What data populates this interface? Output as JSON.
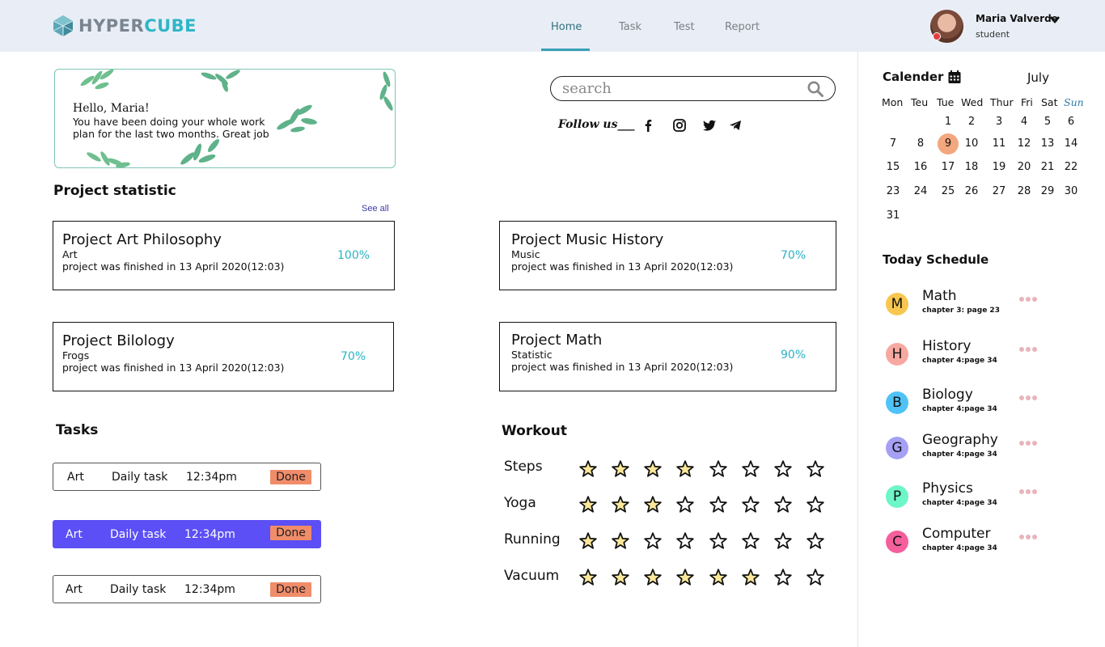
{
  "logo": {
    "part1": "HYPER",
    "part2": "CUBE"
  },
  "nav": [
    "Home",
    "Task",
    "Test",
    "Report"
  ],
  "active_nav": "Home",
  "user": {
    "name": "Maria Valverde",
    "role": "student"
  },
  "hello": {
    "greeting": "Hello, Maria!",
    "message": "You have been doing your whole work plan for the last two months. Great job"
  },
  "search": {
    "placeholder": "search"
  },
  "follow": "Follow us___",
  "social_icons": [
    "facebook-icon",
    "instagram-icon",
    "twitter-icon",
    "telegram-icon"
  ],
  "project_statistic": {
    "title": "Project statistic",
    "see_all": "See all",
    "projects": [
      {
        "title": "Project Art Philosophy",
        "subject": "Art",
        "desc": "project was finished in 13 April 2020(12:03)",
        "percent": "100%"
      },
      {
        "title": "Project Music History",
        "subject": "Music",
        "desc": "project was finished in 13 April 2020(12:03)",
        "percent": "70%"
      },
      {
        "title": "Project Bilology",
        "subject": "Frogs",
        "desc": "project was finished in 13 April 2020(12:03)",
        "percent": "70%"
      },
      {
        "title": "Project Math",
        "subject": "Statistic",
        "desc": "project was finished in 13 April 2020(12:03)",
        "percent": "90%"
      }
    ]
  },
  "tasks": {
    "title": "Tasks",
    "items": [
      {
        "subject": "Art",
        "type": "Daily task",
        "time": "12:34pm",
        "status": "Done"
      },
      {
        "subject": "Art",
        "type": "Daily task",
        "time": "12:34pm",
        "status": "Done"
      },
      {
        "subject": "Art",
        "type": "Daily task",
        "time": "12:34pm",
        "status": "Done"
      }
    ]
  },
  "workout": {
    "title": "Workout",
    "max_stars": 8,
    "rows": [
      {
        "label": "Steps",
        "filled": 4
      },
      {
        "label": "Yoga",
        "filled": 3
      },
      {
        "label": "Running",
        "filled": 2
      },
      {
        "label": "Vacuum",
        "filled": 6
      }
    ]
  },
  "calendar": {
    "title": "Calender",
    "month": "July",
    "weekdays": [
      "Mon",
      "Teu",
      "Tue",
      "Wed",
      "Thur",
      "Fri",
      "Sat",
      "Sun"
    ],
    "weeks": [
      [
        "",
        "",
        "1",
        "2",
        "3",
        "4",
        "5",
        "6"
      ],
      [
        "7",
        "8",
        "9",
        "10",
        "11",
        "12",
        "13",
        "14"
      ],
      [
        "15",
        "16",
        "17",
        "18",
        "19",
        "20",
        "21",
        "22"
      ],
      [
        "23",
        "24",
        "25",
        "26",
        "27",
        "28",
        "29",
        "30"
      ],
      [
        "31",
        "",
        "",
        "",
        "",
        "",
        "",
        ""
      ]
    ],
    "today": "9"
  },
  "schedule": {
    "title": "Today Schedule",
    "items": [
      {
        "letter": "M",
        "subject": "Math",
        "detail": "chapter 3: page 23",
        "color": "#f9c74f"
      },
      {
        "letter": "H",
        "subject": "History",
        "detail": "chapter 4:page 34",
        "color": "#f7a8a0"
      },
      {
        "letter": "B",
        "subject": "Biology",
        "detail": "chapter 4:page 34",
        "color": "#4fc3f7"
      },
      {
        "letter": "G",
        "subject": "Geography",
        "detail": "chapter 4:page 34",
        "color": "#a5a0f5"
      },
      {
        "letter": "P",
        "subject": "Physics",
        "detail": "chapter 4:page 34",
        "color": "#6ef5c8"
      },
      {
        "letter": "C",
        "subject": "Computer",
        "detail": "chapter 4:page 34",
        "color": "#f55f9c"
      }
    ]
  },
  "colors": {
    "accent": "#2fb5c6",
    "highlight_task": "#5b4ff5",
    "done": "#f08c6a",
    "star_fill": "#fbe79a"
  }
}
